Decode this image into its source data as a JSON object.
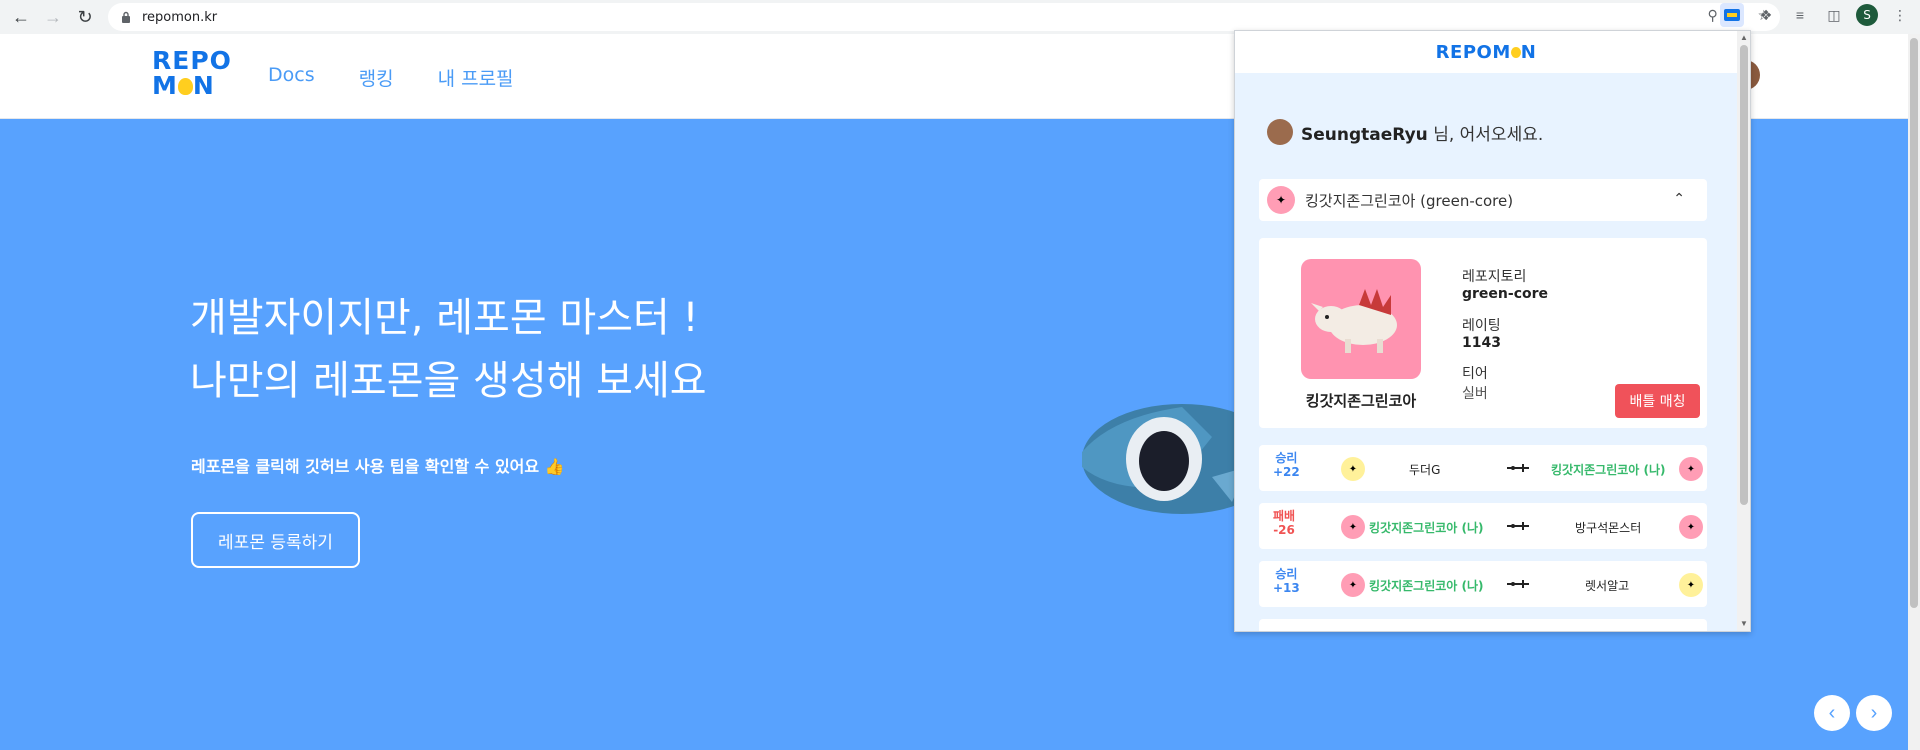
{
  "browser": {
    "url": "repomon.kr",
    "profile_initial": "S"
  },
  "site": {
    "logo_top": "REPO",
    "logo_bottom_left": "M",
    "logo_bottom_right": "N",
    "nav": [
      "Docs",
      "랭킹",
      "내 프로필"
    ]
  },
  "hero": {
    "title_line1": "개발자이지만, 레포몬 마스터 !",
    "title_line2": "나만의 레포몬을 생성해 보세요",
    "subtitle": "레포몬을 클릭해 깃허브 사용 팁을 확인할 수 있어요 👍",
    "button": "레포몬 등록하기",
    "bg_color": "#58a2fe"
  },
  "popup": {
    "logo_left": "REPOM",
    "logo_right": "N",
    "username": "SeungtaeRyu",
    "greeting_suffix": " 님, 어서오세요.",
    "selected_repo": "킹갓지존그린코아 (green-core)",
    "card": {
      "pet_name": "킹갓지존그린코아",
      "repo_label": "레포지토리",
      "repo_value": "green-core",
      "rating_label": "레이팅",
      "rating_value": "1143",
      "tier_label": "티어",
      "tier_value": "실버",
      "battle_button": "배틀 매칭"
    },
    "matches": [
      {
        "result": "승리",
        "delta": "+22",
        "left": "두더G",
        "right": "킹갓지존그린코아 (나)",
        "me_side": "right"
      },
      {
        "result": "패배",
        "delta": "-26",
        "left": "킹갓지존그린코아 (나)",
        "right": "방구석몬스터",
        "me_side": "left"
      },
      {
        "result": "승리",
        "delta": "+13",
        "left": "킹갓지존그린코아 (나)",
        "right": "렛서알고",
        "me_side": "left"
      }
    ]
  }
}
